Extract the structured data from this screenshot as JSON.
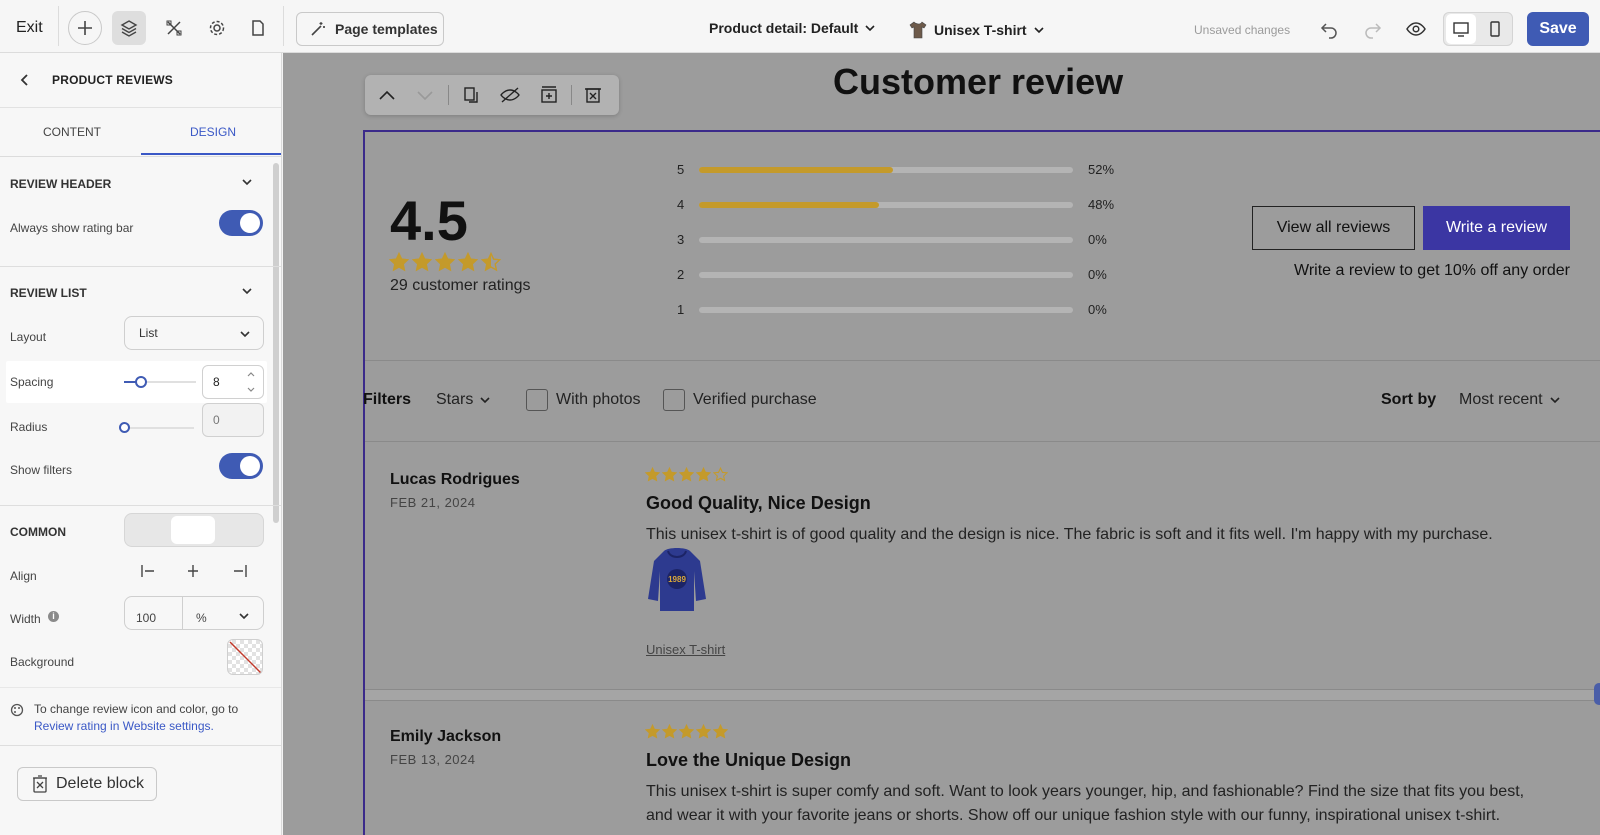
{
  "topbar": {
    "exit_label": "Exit",
    "page_templates_label": "Page templates",
    "page_selector": "Product detail: Default",
    "product_selector": "Unisex T-shirt",
    "unsaved_label": "Unsaved changes",
    "save_label": "Save"
  },
  "sidebar": {
    "title": "PRODUCT REVIEWS",
    "tabs": [
      {
        "label": "CONTENT"
      },
      {
        "label": "DESIGN"
      }
    ],
    "review_header": {
      "title": "REVIEW HEADER",
      "always_show_rating_bar": "Always show rating bar"
    },
    "review_list": {
      "title": "REVIEW LIST",
      "layout_label": "Layout",
      "layout_value": "List",
      "spacing_label": "Spacing",
      "spacing_value": "8",
      "radius_label": "Radius",
      "radius_value": "0",
      "show_filters_label": "Show filters"
    },
    "common": {
      "title": "COMMON",
      "align_label": "Align",
      "width_label": "Width",
      "width_value": "100",
      "width_unit": "%",
      "background_label": "Background"
    },
    "info_text": "To change review icon and color, go to",
    "info_link": "Review rating in Website settings.",
    "delete_label": "Delete block"
  },
  "canvas": {
    "heading": "Customer review",
    "average_rating": "4.5",
    "average_stars": 4.5,
    "ratings_count": "29 customer ratings",
    "distribution": [
      {
        "star": "5",
        "pct": "52%",
        "fill": 0.52
      },
      {
        "star": "4",
        "pct": "48%",
        "fill": 0.48
      },
      {
        "star": "3",
        "pct": "0%",
        "fill": 0
      },
      {
        "star": "2",
        "pct": "0%",
        "fill": 0
      },
      {
        "star": "1",
        "pct": "0%",
        "fill": 0
      }
    ],
    "view_all_label": "View all reviews",
    "write_review_label": "Write a review",
    "promo_text": "Write a review to get 10% off any order",
    "filters": {
      "label": "Filters",
      "stars": "Stars",
      "with_photos": "With photos",
      "verified": "Verified purchase",
      "sort_label": "Sort by",
      "sort_value": "Most recent"
    },
    "reviews": [
      {
        "name": "Lucas Rodrigues",
        "date": "FEB 21, 2024",
        "rating": 4,
        "title": "Good Quality, Nice Design",
        "body": "This unisex t-shirt is of good quality and the design is nice. The fabric is soft and it fits well. I'm happy with my purchase.",
        "product": "Unisex T-shirt",
        "hoodie_print": "1989"
      },
      {
        "name": "Emily Jackson",
        "date": "FEB 13, 2024",
        "rating": 5,
        "title": "Love the Unique Design",
        "body_line1": "This unisex t-shirt is super comfy and soft. Want to look years younger, hip, and fashionable? Find the size that fits you best,",
        "body_line2": "and wear it with your favorite jeans or shorts. Show off our unique fashion style with our funny, inspirational unisex t-shirt."
      }
    ]
  },
  "colors": {
    "accent": "#3f5bb4",
    "primary_button": "#3b36a3",
    "star": "#c49a2b",
    "overlay": "#9c9c9c"
  }
}
